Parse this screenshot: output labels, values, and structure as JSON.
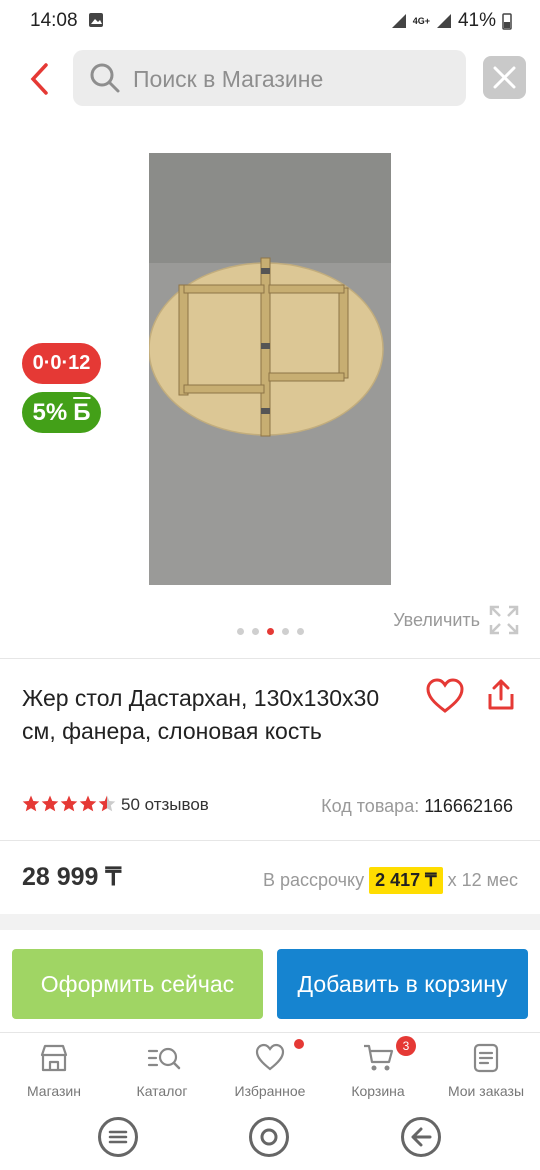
{
  "status_bar": {
    "time": "14:08",
    "network": "4G+",
    "battery": "41%"
  },
  "search": {
    "placeholder": "Поиск в Магазине"
  },
  "badges": {
    "installment_badge": "0·0·12",
    "bonus_badge": "5%",
    "bonus_currency": "Б"
  },
  "gallery": {
    "zoom_label": "Увеличить",
    "dots_count": 5,
    "active_dot": 2
  },
  "product": {
    "title": "Жер стол Дастархан, 130x130x30 см, фанера, слоновая кость",
    "rating": 4.5,
    "reviews": "50 отзывов",
    "code_label": "Код товара:",
    "code_value": "116662166"
  },
  "price": {
    "value": "28 999 ₸",
    "installment_label": "В рассрочку",
    "installment_amount": "2 417 ₸",
    "installment_term": "x 12 мес"
  },
  "actions": {
    "buy_now": "Оформить сейчас",
    "add_to_cart": "Добавить в корзину"
  },
  "bottom_nav": {
    "items": [
      {
        "label": "Магазин",
        "icon": "store-icon"
      },
      {
        "label": "Каталог",
        "icon": "catalog-search-icon"
      },
      {
        "label": "Избранное",
        "icon": "heart-icon"
      },
      {
        "label": "Корзина",
        "icon": "cart-icon",
        "badge": "3"
      },
      {
        "label": "Мои заказы",
        "icon": "orders-icon"
      }
    ]
  },
  "colors": {
    "accent_red": "#e53935",
    "green": "#43a018",
    "buy_btn": "#a0d564",
    "cart_btn": "#1684d0",
    "installment_highlight": "#ffdd00"
  }
}
